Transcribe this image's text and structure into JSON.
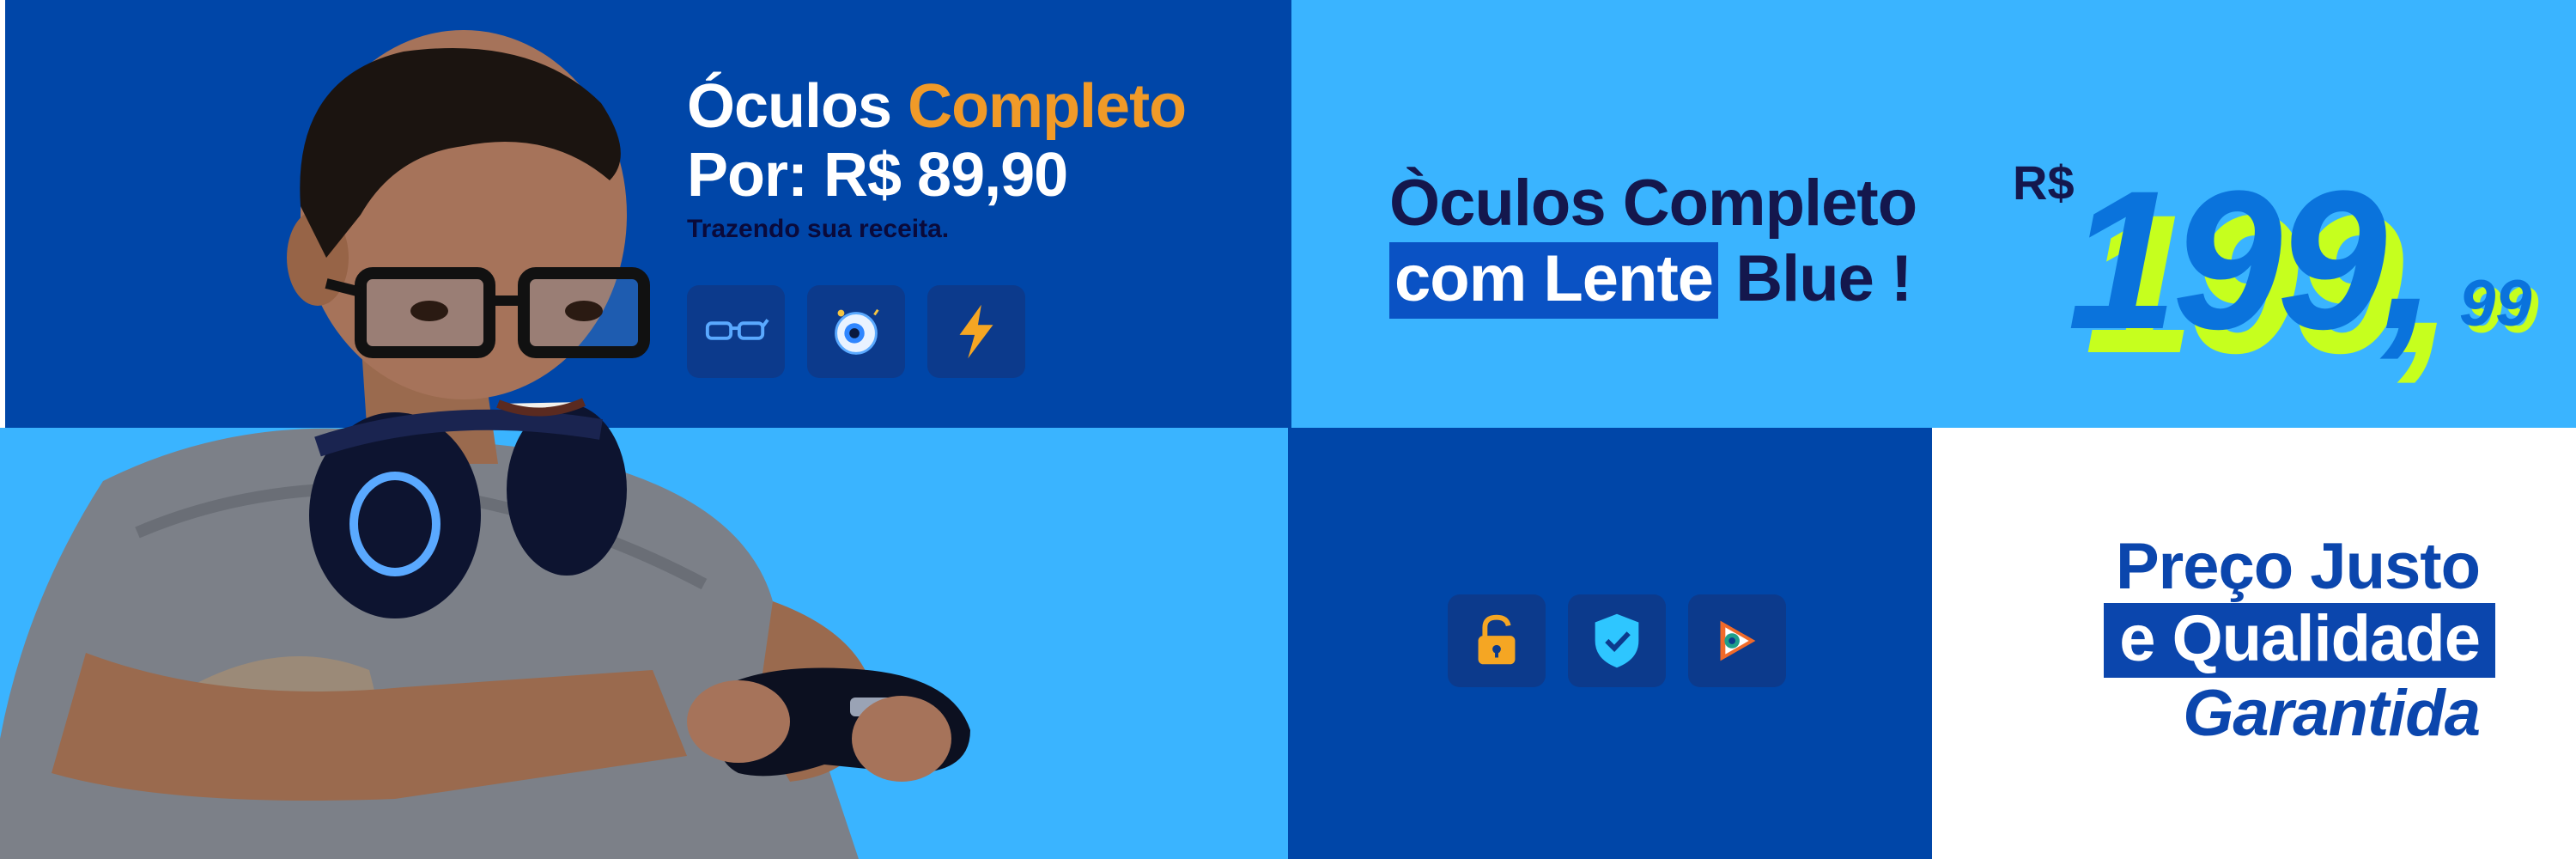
{
  "promo": {
    "title_word1": "Óculos",
    "title_word2": "Completo",
    "price": "Por: R$ 89,90",
    "note": "Trazendo sua  receita."
  },
  "blue_offer": {
    "line1": "Òculos Completo",
    "line2_highlight": "com Lente",
    "line2_rest": " Blue !"
  },
  "big_price": {
    "currency": "R$",
    "integer": "199,",
    "cents": "99"
  },
  "slogan": {
    "line1": "Preço Justo",
    "line2": "e Qualidade",
    "line3": "Garantida"
  },
  "icons": {
    "top": [
      "glasses-icon",
      "eye-icon",
      "lightning-icon"
    ],
    "bottom": [
      "unlock-icon",
      "shield-check-icon",
      "eye-lens-icon"
    ]
  },
  "colors": {
    "dark_blue": "#0046a8",
    "light_blue": "#3ab4ff",
    "orange_accent": "#f09a28",
    "lime_shadow": "#c6ff1e",
    "navy_text": "#14174d"
  }
}
